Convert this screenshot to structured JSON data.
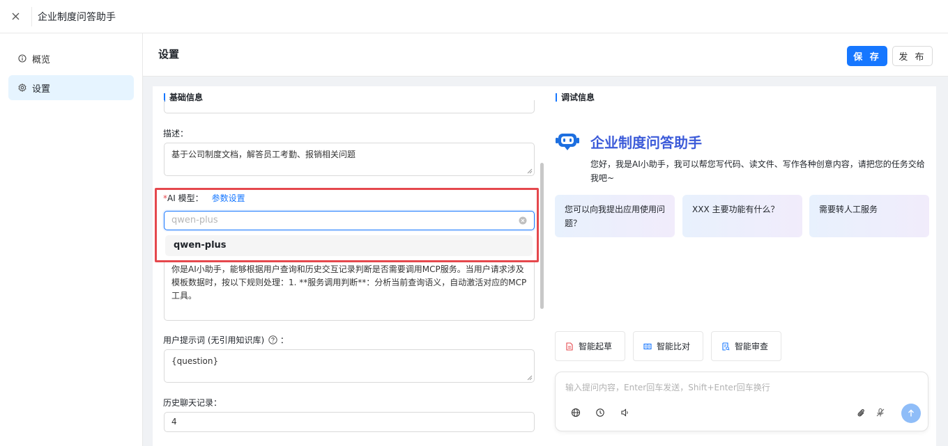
{
  "topbar": {
    "close_icon": "close-icon",
    "title": "企业制度问答助手"
  },
  "sidebar": {
    "items": [
      {
        "label": "概览",
        "icon": "info-circle-icon"
      },
      {
        "label": "设置",
        "icon": "gear-icon",
        "active": true
      }
    ]
  },
  "header": {
    "title": "设置",
    "save_label": "保 存",
    "publish_label": "发 布"
  },
  "basic": {
    "section_title": "基础信息",
    "desc_label": "描述：",
    "desc_value": "基于公司制度文档，解答员工考勤、报销相关问题",
    "model_label": "AI 模型：",
    "param_link": "参数设置",
    "model_placeholder": "qwen-plus",
    "model_option": "qwen-plus",
    "system_prompt": "你是AI小助手，能够根据用户查询和历史交互记录判断是否需要调用MCP服务。当用户请求涉及模板数据时，按以下规则处理：1. **服务调用判断**：分析当前查询语义，自动激活对应的MCP工具。",
    "user_prompt_label": "用户提示词 (无引用知识库)",
    "user_prompt_value": "{question}",
    "history_label": "历史聊天记录：",
    "history_value": "4"
  },
  "debug": {
    "section_title": "调试信息",
    "agent_name": "企业制度问答助手",
    "greeting": "您好，我是AI小助手，我可以帮您写代码、读文件、写作各种创意内容，请把您的任务交给我吧~",
    "suggestions": [
      "您可以向我提出应用使用问题？",
      "XXX 主要功能有什么？",
      "需要转人工服务"
    ],
    "tools": [
      {
        "label": "智能起草",
        "icon": "document-icon"
      },
      {
        "label": "智能比对",
        "icon": "compare-icon"
      },
      {
        "label": "智能审查",
        "icon": "review-icon"
      }
    ],
    "chat_placeholder": "输入提问内容，Enter回车发送，Shift+Enter回车换行"
  },
  "colors": {
    "primary": "#1677ff",
    "highlight": "#e5484d",
    "active_bg": "#e6f4ff"
  }
}
